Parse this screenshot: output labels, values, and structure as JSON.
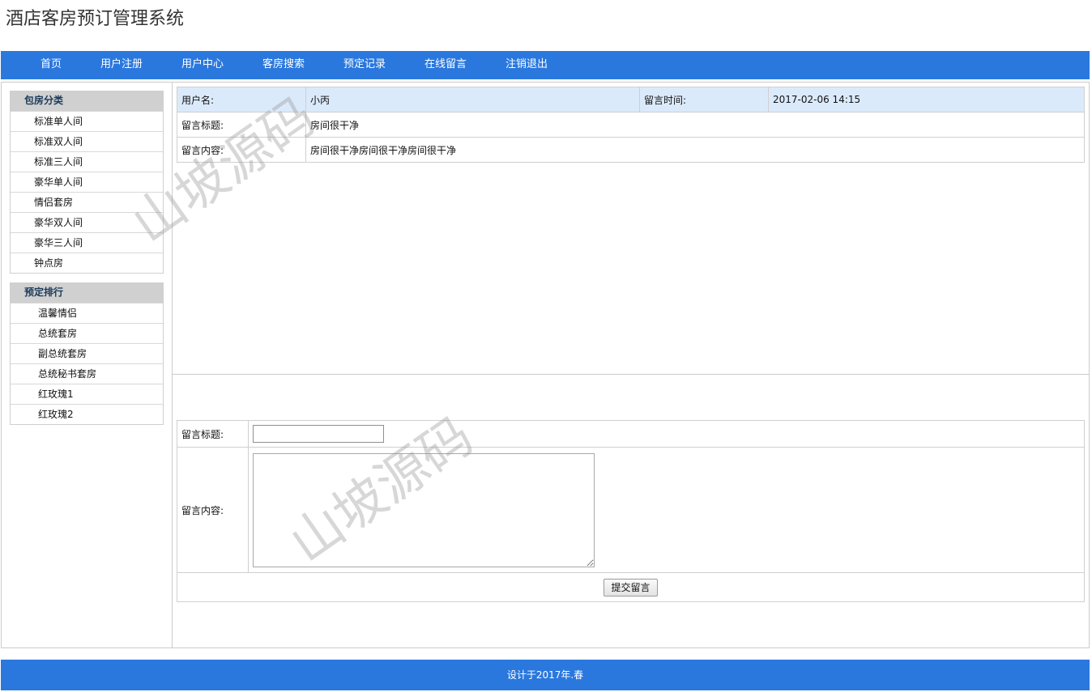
{
  "site": {
    "title": "酒店客房预订管理系统"
  },
  "nav": {
    "items": [
      "首页",
      "用户注册",
      "用户中心",
      "客房搜索",
      "预定记录",
      "在线留言",
      "注销退出"
    ]
  },
  "sidebar": {
    "category": {
      "title": "包房分类",
      "items": [
        "标准单人间",
        "标准双人间",
        "标准三人间",
        "豪华单人间",
        "情侣套房",
        "豪华双人间",
        "豪华三人间",
        "钟点房"
      ]
    },
    "ranking": {
      "title": "预定排行",
      "items": [
        "温馨情侣",
        "总统套房",
        "副总统套房",
        "总统秘书套房",
        "红玫瑰1",
        "红玫瑰2"
      ]
    }
  },
  "message": {
    "user_label": "用户名:",
    "user_value": "小丙",
    "time_label": "留言时间:",
    "time_value": "2017-02-06 14:15",
    "title_label": "留言标题:",
    "title_value": "房间很干净",
    "content_label": "留言内容:",
    "content_value": "房间很干净房间很干净房间很干净"
  },
  "form": {
    "title_label": "留言标题:",
    "title_value": "",
    "content_label": "留言内容:",
    "content_value": "",
    "submit_label": "提交留言"
  },
  "watermark": {
    "text": "山坡源码"
  },
  "footer": {
    "text": "设计于2017年.春"
  },
  "colors": {
    "nav_bg": "#2a78de",
    "header_row_bg": "#dbeafb",
    "sidebar_head_bg": "#d0d0d0"
  }
}
